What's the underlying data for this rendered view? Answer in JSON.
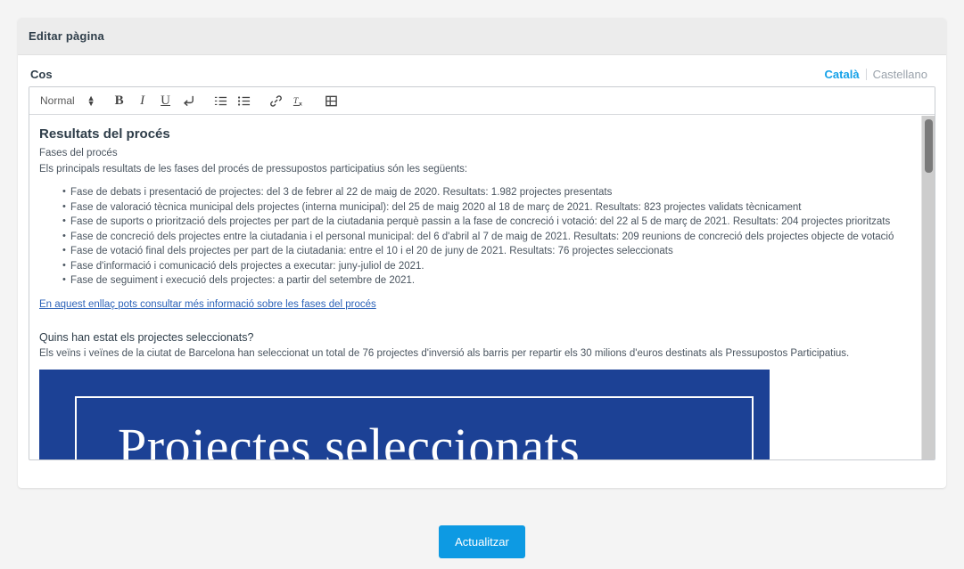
{
  "window": {
    "title": "Editar pàgina"
  },
  "field": {
    "label": "Cos",
    "languages": [
      {
        "label": "Català",
        "active": true
      },
      {
        "label": "Castellano",
        "active": false
      }
    ]
  },
  "toolbar": {
    "format_picker": {
      "value": "Normal",
      "icon": "updown-arrows-icon"
    },
    "buttons": [
      {
        "name": "bold-button",
        "label": "B",
        "icon": "bold-icon"
      },
      {
        "name": "italic-button",
        "label": "I",
        "icon": "italic-icon"
      },
      {
        "name": "underline-button",
        "label": "U",
        "icon": "underline-icon"
      },
      {
        "name": "blockquote-button",
        "label": "",
        "icon": "return-arrow-icon"
      },
      {
        "name": "ordered-list-button",
        "label": "",
        "icon": "ordered-list-icon"
      },
      {
        "name": "unordered-list-button",
        "label": "",
        "icon": "unordered-list-icon"
      },
      {
        "name": "link-button",
        "label": "",
        "icon": "link-icon"
      },
      {
        "name": "clear-format-button",
        "label": "",
        "icon": "clear-formatting-icon"
      },
      {
        "name": "video-button",
        "label": "",
        "icon": "film-icon"
      }
    ]
  },
  "document": {
    "heading": "Resultats del procés",
    "subheading": "Fases del procés",
    "intro": "Els principals resultats de les fases del procés de pressupostos participatius són les següents:",
    "bullets": [
      "Fase de debats i presentació de projectes: del 3 de febrer al 22 de maig de 2020. Resultats: 1.982 projectes presentats",
      "Fase de valoració tècnica municipal dels projectes (interna municipal): del 25 de maig 2020 al 18 de març de 2021. Resultats: 823 projectes validats tècnicament",
      "Fase de suports o priorització dels projectes per part de la ciutadania perquè passin a la fase de concreció i votació: del 22 al 5 de març de 2021. Resultats: 204 projectes prioritzats",
      "Fase de concreció dels projectes entre la ciutadania i el personal municipal: del 6 d'abril al 7 de maig de 2021. Resultats: 209 reunions de concreció dels projectes objecte de votació",
      "Fase de votació final dels projectes per part de la ciutadania: entre el 10 i el 20 de juny de 2021. Resultats: 76 projectes seleccionats",
      "Fase d'informació i comunicació dels projectes a executar: juny-juliol de 2021.",
      "Fase de seguiment i execució dels projectes: a partir del setembre de 2021."
    ],
    "link_text": "En aquest enllaç pots consultar més informació sobre les fases del procés",
    "question": "Quins han estat els projectes seleccionats?",
    "answer": "Els veïns i veïnes de la ciutat de Barcelona han seleccionat un total de 76 projectes d'inversió als barris per repartir els 30 milions d'euros destinats als Pressupostos Participatius.",
    "banner": {
      "text": "Projectes seleccionats",
      "background_color": "#1c4195",
      "text_color": "#ffffff"
    }
  },
  "footer": {
    "update_button": "Actualitzar"
  },
  "colors": {
    "accent": "#0d9ae3",
    "active_tab": "#14a1e8",
    "link": "#2b62b8",
    "header_band": "#ececec",
    "page_background": "#f4f4f4"
  }
}
